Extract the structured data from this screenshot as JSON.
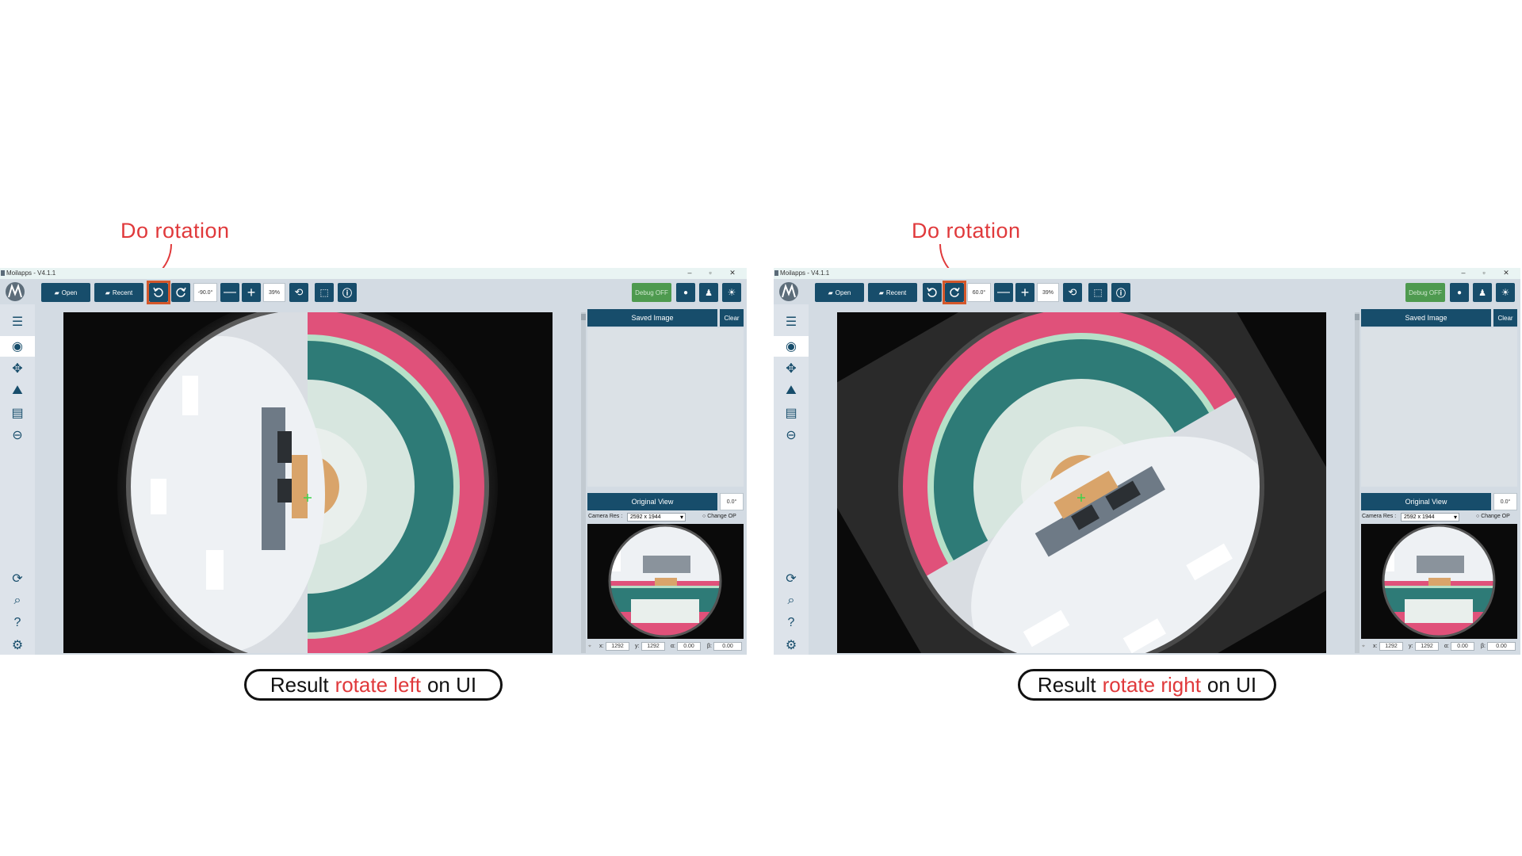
{
  "annotations": {
    "left_title": "Do  rotation",
    "right_title": "Do  rotation",
    "left_result": {
      "prefix": "Result",
      "highlight": "rotate left",
      "suffix": "on UI"
    },
    "right_result": {
      "prefix": "Result",
      "highlight": "rotate right",
      "suffix": "on UI"
    },
    "accent_color": "#e0393b"
  },
  "windows": [
    {
      "title": "Moilapps - V4.1.1",
      "toolbar": {
        "open_label": "Open",
        "recent_label": "Recent",
        "rotation_value": "-90.0°",
        "zoom_value": "39%",
        "debug_label": "Debug OFF",
        "highlighted_button": "rotate-left"
      },
      "right_panel": {
        "saved_image_label": "Saved Image",
        "clear_label": "Clear",
        "original_view_label": "Original View",
        "original_deg": "0.0°",
        "camera_res_label": "Camera Res :",
        "camera_res_value": "2592 x 1944",
        "change_op_label": "Change OP",
        "x_label": "x:",
        "x_value": "1292",
        "y_label": "y:",
        "y_value": "1292",
        "alpha_label": "α:",
        "alpha_value": "0.00",
        "beta_label": "β:",
        "beta_value": "0.00"
      }
    },
    {
      "title": "Moilapps - V4.1.1",
      "toolbar": {
        "open_label": "Open",
        "recent_label": "Recent",
        "rotation_value": "60.0°",
        "zoom_value": "39%",
        "debug_label": "Debug OFF",
        "highlighted_button": "rotate-right"
      },
      "right_panel": {
        "saved_image_label": "Saved Image",
        "clear_label": "Clear",
        "original_view_label": "Original View",
        "original_deg": "0.0°",
        "camera_res_label": "Camera Res :",
        "camera_res_value": "2592 x 1944",
        "change_op_label": "Change OP",
        "x_label": "x:",
        "x_value": "1292",
        "y_label": "y:",
        "y_value": "1292",
        "alpha_label": "α:",
        "alpha_value": "0.00",
        "beta_label": "β:",
        "beta_value": "0.00"
      }
    }
  ],
  "colors": {
    "primary": "#174d6b",
    "toolbar_bg": "#d3dbe3",
    "debug_green": "#4e9a4f",
    "highlight": "#d4572a",
    "fisheye_pink": "#e0517a",
    "fisheye_teal": "#2e7b77"
  }
}
